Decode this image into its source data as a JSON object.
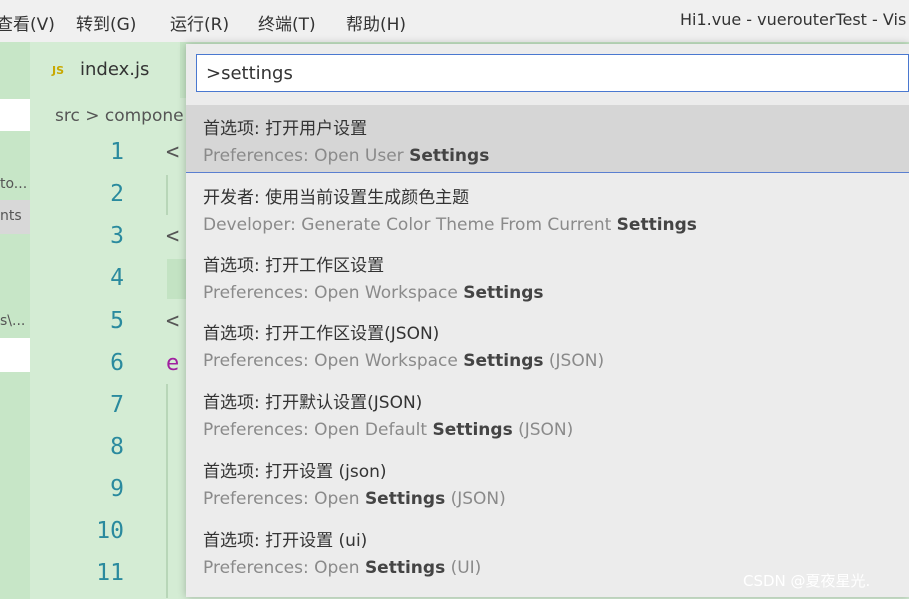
{
  "menubar": {
    "items": [
      "查看(V)",
      "转到(G)",
      "运行(R)",
      "终端(T)",
      "帮助(H)"
    ],
    "title": "Hi1.vue - vuerouterTest - Vis"
  },
  "sidebar": {
    "texts": [
      "to...",
      "nts",
      "s\\..."
    ]
  },
  "editor": {
    "tab": {
      "icon": "JS",
      "label": "index.js"
    },
    "breadcrumb": "src > compone",
    "line_numbers": [
      "1",
      "2",
      "3",
      "4",
      "5",
      "6",
      "7",
      "8",
      "9",
      "10",
      "11"
    ],
    "code": [
      "<",
      "<",
      "<",
      "e"
    ]
  },
  "palette": {
    "input_value": ">settings",
    "highlight": "Settings",
    "items": [
      {
        "label": "首选项: 打开用户设置",
        "pre": "Preferences: Open User ",
        "post": ""
      },
      {
        "label": "开发者: 使用当前设置生成颜色主题",
        "pre": "Developer: Generate Color Theme From Current ",
        "post": ""
      },
      {
        "label": "首选项: 打开工作区设置",
        "pre": "Preferences: Open Workspace ",
        "post": ""
      },
      {
        "label": "首选项: 打开工作区设置(JSON)",
        "pre": "Preferences: Open Workspace ",
        "post": " (JSON)"
      },
      {
        "label": "首选项: 打开默认设置(JSON)",
        "pre": "Preferences: Open Default ",
        "post": " (JSON)"
      },
      {
        "label": "首选项: 打开设置 (json)",
        "pre": "Preferences: Open ",
        "post": " (JSON)"
      },
      {
        "label": "首选项: 打开设置 (ui)",
        "pre": "Preferences: Open ",
        "post": " (UI)"
      }
    ]
  },
  "watermark": "CSDN @夏夜星光.",
  "colors": {
    "background": "#d4ecd4",
    "accent": "#4a78d0",
    "line_number": "#2a8a9e"
  }
}
